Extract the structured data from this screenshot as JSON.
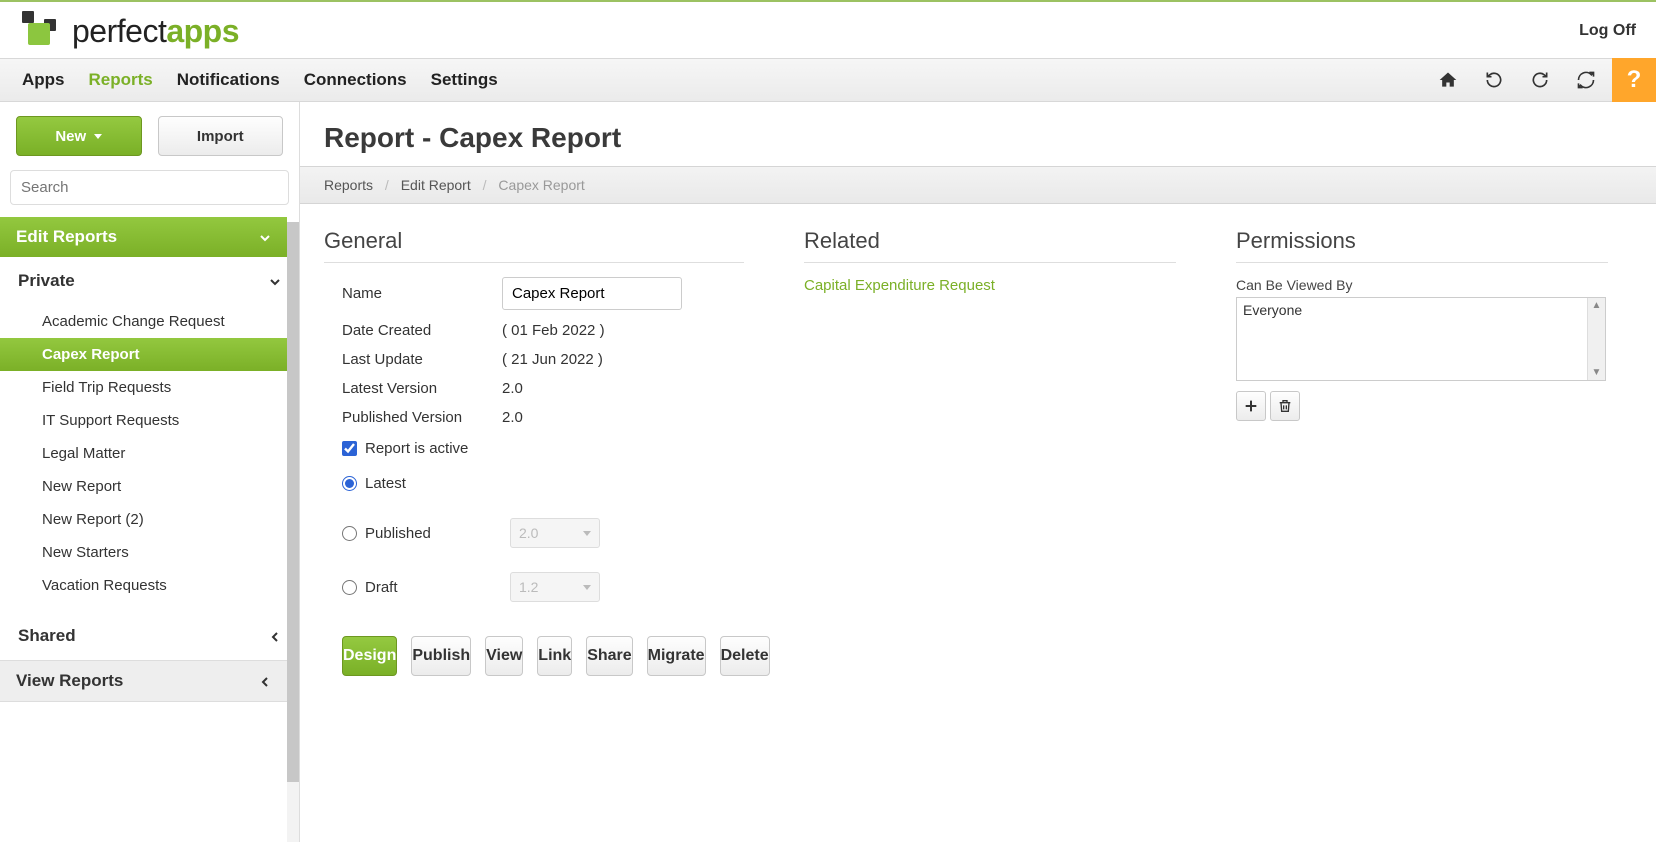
{
  "header": {
    "brand_left": "perfect",
    "brand_right": "apps",
    "logoff": "Log Off"
  },
  "nav": {
    "items": [
      "Apps",
      "Reports",
      "Notifications",
      "Connections",
      "Settings"
    ],
    "active_index": 1,
    "help": "?"
  },
  "sidebar": {
    "new_label": "New",
    "import_label": "Import",
    "search_placeholder": "Search",
    "sections": {
      "edit_reports": "Edit Reports",
      "private": "Private",
      "shared": "Shared",
      "view_reports": "View Reports"
    },
    "private_items": [
      "Academic Change Request",
      "Capex Report",
      "Field Trip Requests",
      "IT Support Requests",
      "Legal Matter",
      "New Report",
      "New Report (2)",
      "New Starters",
      "Vacation Requests"
    ],
    "active_private_index": 1
  },
  "page": {
    "title": "Report - Capex Report",
    "breadcrumb": [
      "Reports",
      "Edit Report",
      "Capex Report"
    ]
  },
  "general": {
    "heading": "General",
    "labels": {
      "name": "Name",
      "date_created": "Date Created",
      "last_update": "Last Update",
      "latest_version": "Latest Version",
      "published_version": "Published Version",
      "report_active": "Report is active",
      "latest": "Latest",
      "published": "Published",
      "draft": "Draft"
    },
    "values": {
      "name": "Capex Report",
      "date_created": "( 01 Feb 2022 )",
      "last_update": "( 21 Jun 2022 )",
      "latest_version": "2.0",
      "published_version": "2.0",
      "published_select": "2.0",
      "draft_select": "1.2"
    }
  },
  "related": {
    "heading": "Related",
    "items": [
      "Capital Expenditure Request"
    ]
  },
  "permissions": {
    "heading": "Permissions",
    "viewed_by_label": "Can Be Viewed By",
    "viewed_by_items": [
      "Everyone"
    ]
  },
  "actions": {
    "design": "Design",
    "publish": "Publish",
    "view": "View",
    "link": "Link",
    "share": "Share",
    "migrate": "Migrate",
    "delete": "Delete"
  }
}
